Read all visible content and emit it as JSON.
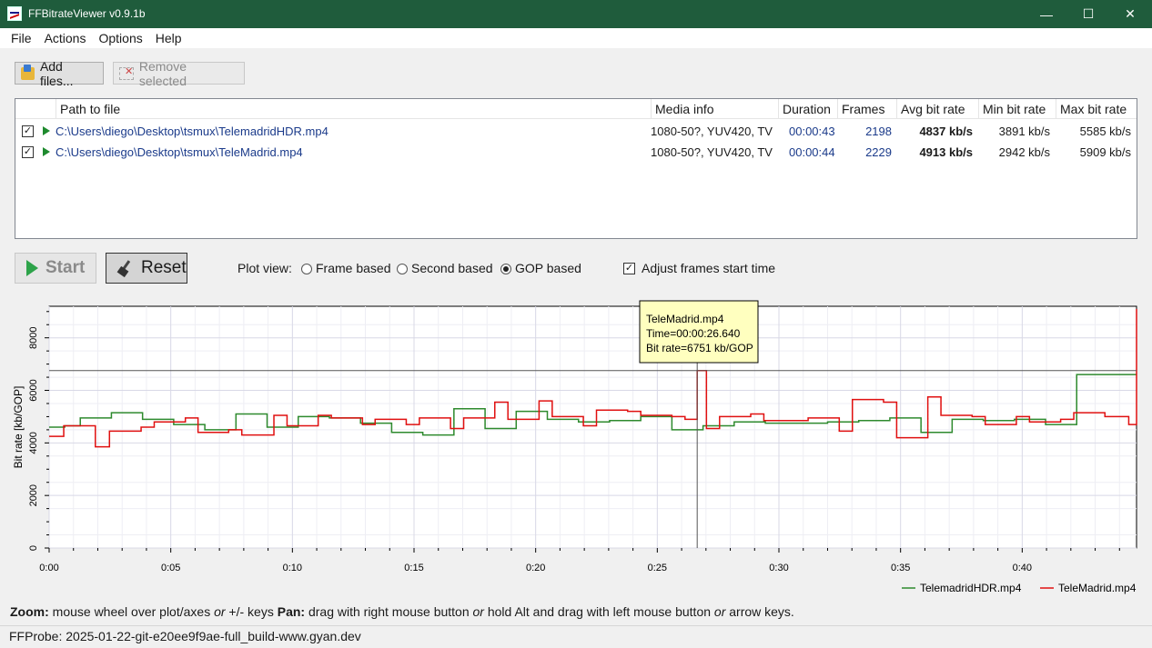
{
  "window": {
    "title": "FFBitrateViewer v0.9.1b",
    "minimize_glyph": "—",
    "maximize_glyph": "☐",
    "close_glyph": "✕"
  },
  "menu": [
    "File",
    "Actions",
    "Options",
    "Help"
  ],
  "toolbar": {
    "add_files_label": "Add files...",
    "remove_selected_label": "Remove selected"
  },
  "file_list": {
    "columns": [
      "Path to file",
      "Media info",
      "Duration",
      "Frames",
      "Avg bit rate",
      "Min bit rate",
      "Max bit rate"
    ],
    "rows": [
      {
        "checked": true,
        "path": "C:\\Users\\diego\\Desktop\\tsmux\\TelemadridHDR.mp4",
        "media_info": "1080-50?, YUV420, TV",
        "duration": "00:00:43",
        "frames": "2198",
        "avg": "4837 kb/s",
        "min": "3891 kb/s",
        "max": "5585 kb/s"
      },
      {
        "checked": true,
        "path": "C:\\Users\\diego\\Desktop\\tsmux\\TeleMadrid.mp4",
        "media_info": "1080-50?, YUV420, TV",
        "duration": "00:00:44",
        "frames": "2229",
        "avg": "4913 kb/s",
        "min": "2942 kb/s",
        "max": "5909 kb/s"
      }
    ]
  },
  "controls": {
    "start_label": "Start",
    "reset_label": "Reset",
    "plot_view_label": "Plot view:",
    "plot_view_options": [
      "Frame based",
      "Second based",
      "GOP based"
    ],
    "plot_view_selected": "GOP based",
    "adjust_label": "Adjust frames start time",
    "adjust_checked": true
  },
  "tooltip": {
    "file": "TeleMadrid.mp4",
    "time": "Time=00:00:26.640",
    "bitrate": "Bit rate=6751 kb/GOP"
  },
  "chart_data": {
    "type": "line",
    "ylabel": "Bit rate [kb/GOP]",
    "xlabel": "",
    "x_unit": "seconds",
    "xlim": [
      0,
      44.7
    ],
    "ylim": [
      0,
      9200
    ],
    "x_ticks": [
      0,
      5,
      10,
      15,
      20,
      25,
      30,
      35,
      40
    ],
    "x_tick_labels": [
      "0:00",
      "0:05",
      "0:10",
      "0:15",
      "0:20",
      "0:25",
      "0:30",
      "0:35",
      "0:40"
    ],
    "y_ticks": [
      0,
      2000,
      4000,
      6000,
      8000
    ],
    "y_tick_labels": [
      "0",
      "2000",
      "4000",
      "6000",
      "8000"
    ],
    "grid": true,
    "legend_position": "bottom-right",
    "crosshair": {
      "x": 26.64,
      "y": 6751
    },
    "series": [
      {
        "name": "TelemadridHDR.mp4",
        "color": "#2e8a2e",
        "step_x": [
          0,
          0.64,
          1.28,
          2.56,
          3.84,
          5.12,
          6.4,
          7.68,
          8.96,
          10.24,
          11.52,
          12.8,
          14.08,
          15.36,
          16.64,
          17.92,
          19.2,
          20.48,
          21.76,
          23.04,
          24.32,
          25.6,
          26.88,
          28.16,
          29.44,
          30.72,
          32.0,
          33.28,
          34.56,
          35.84,
          37.12,
          38.4,
          39.68,
          40.96,
          42.24,
          43.52,
          43.9
        ],
        "step_y": [
          4600,
          4650,
          4950,
          5150,
          4900,
          4700,
          4500,
          5100,
          4600,
          5000,
          4950,
          4750,
          4400,
          4300,
          5300,
          4550,
          5200,
          4900,
          4800,
          4850,
          5000,
          4500,
          4650,
          4800,
          4750,
          4750,
          4800,
          4850,
          4950,
          4400,
          4900,
          4850,
          4900,
          4700,
          6600,
          6600,
          6600
        ]
      },
      {
        "name": "TeleMadrid.mp4",
        "color": "#e01010",
        "step_x": [
          0,
          0.6,
          1.9,
          2.48,
          3.78,
          4.32,
          5.6,
          6.12,
          7.38,
          7.92,
          9.24,
          9.78,
          11.06,
          11.6,
          12.88,
          13.4,
          14.68,
          15.22,
          16.5,
          17.04,
          18.32,
          18.86,
          20.14,
          20.68,
          21.96,
          22.5,
          23.78,
          24.32,
          25.6,
          26.14,
          26.64,
          27.02,
          27.56,
          28.84,
          29.38,
          30.66,
          31.2,
          32.48,
          33.02,
          34.3,
          34.84,
          36.12,
          36.66,
          37.94,
          38.48,
          39.76,
          40.3,
          41.58,
          42.12,
          43.4,
          44.38,
          44.7
        ],
        "step_y": [
          4250,
          4650,
          3850,
          4450,
          4600,
          4800,
          4950,
          4400,
          4500,
          4300,
          5050,
          4650,
          5050,
          4950,
          4700,
          4900,
          4700,
          4950,
          4550,
          4950,
          5550,
          4900,
          5600,
          5000,
          4650,
          5250,
          5200,
          5050,
          5000,
          4900,
          6751,
          4550,
          5000,
          5100,
          4850,
          4850,
          4950,
          4450,
          5650,
          5550,
          4200,
          5750,
          5050,
          5000,
          4700,
          5000,
          4800,
          4900,
          5150,
          5000,
          4700,
          9100
        ]
      }
    ]
  },
  "hint": {
    "zoom_label": "Zoom:",
    "zoom_text": " mouse wheel over plot/axes ",
    "or1": "or",
    "zoom_text2": " +/- keys ",
    "pan_label": "Pan:",
    "pan_text": " drag with right mouse button ",
    "or2": "or",
    "pan_text2": " hold Alt and drag with left mouse button ",
    "or3": "or",
    "pan_text3": " arrow keys."
  },
  "status": "FFProbe: 2025-01-22-git-e20ee9f9ae-full_build-www.gyan.dev"
}
